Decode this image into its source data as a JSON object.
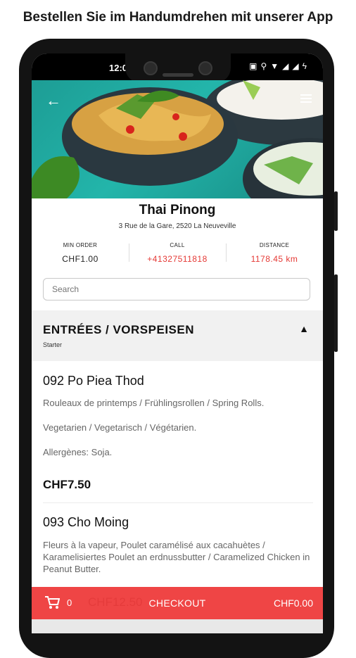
{
  "headline": "Bestellen Sie im Handumdrehen mit unserer App",
  "status": {
    "time": "12:0"
  },
  "restaurant": {
    "name": "Thai Pinong",
    "address": "3 Rue de la Gare, 2520 La Neuveville"
  },
  "info": {
    "min_order": {
      "label": "MIN ORDER",
      "value": "CHF1.00"
    },
    "call": {
      "label": "CALL",
      "value": "+41327511818"
    },
    "distance": {
      "label": "DISTANCE",
      "value": "1178.45  km"
    }
  },
  "search": {
    "placeholder": "Search"
  },
  "category": {
    "title": "ENTRÉES / VORSPEISEN",
    "subtitle": "Starter"
  },
  "items": [
    {
      "name": "092 Po Piea Thod",
      "desc1": "Rouleaux de printemps / Frühlingsrollen / Spring Rolls.",
      "desc2": "Vegetarien / Vegetarisch / Végétarien.",
      "desc3": "Allergènes: Soja.",
      "price": "CHF7.50"
    },
    {
      "name": "093 Cho Moing",
      "desc1": "Fleurs à la vapeur, Poulet caramélisé aux cacahuètes / Karamelisiertes Poulet an erdnussbutter / Caramelized Chicken in Peanut Butter.",
      "price": "CHF12.50"
    }
  ],
  "checkout": {
    "count": "0",
    "label": "CHECKOUT",
    "total": "CHF0.00"
  },
  "colors": {
    "accent": "#ef4545",
    "link": "#e53935",
    "hero": "#1d9d95"
  },
  "icons": [
    "back-arrow-icon",
    "menu-icon",
    "chevron-up-icon",
    "cart-icon",
    "location-icon",
    "wifi-icon",
    "battery-icon"
  ]
}
